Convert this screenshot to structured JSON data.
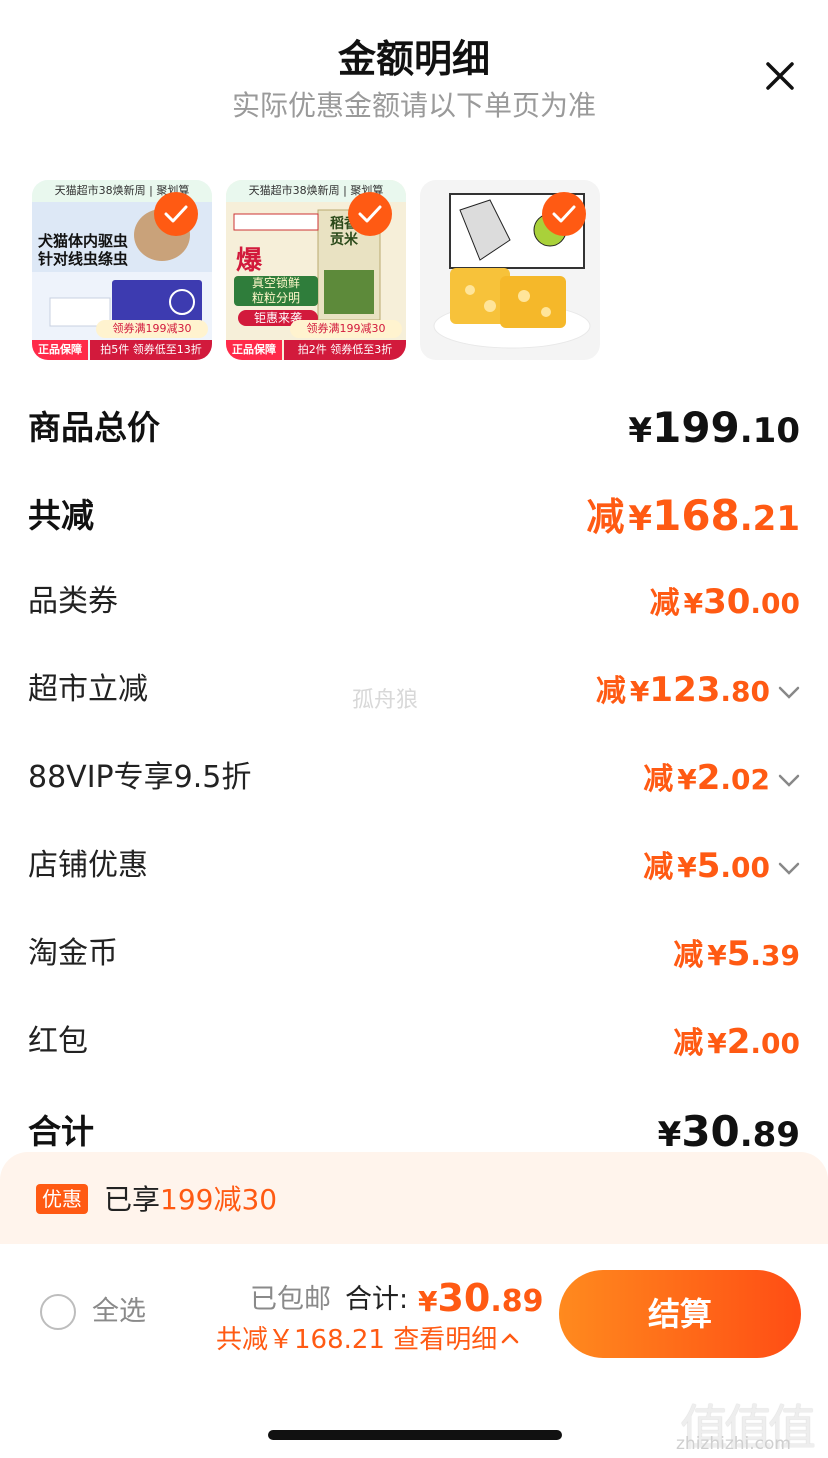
{
  "header": {
    "title": "金额明细",
    "subtitle": "实际优惠金额请以下单页为准"
  },
  "products": [
    {
      "top_banner": "天猫超市38焕新周 | 聚划算",
      "lines": [
        "犬猫体内驱虫",
        "针对线虫绦虫"
      ],
      "badge": "正品保障",
      "coupon": "领券满199减30",
      "promo": "拍5件 领券低至13折",
      "selected": true
    },
    {
      "top_banner": "天猫超市38焕新周 | 聚划算",
      "lines": [
        "爆",
        "稻香贡米",
        "真空锁鲜",
        "粒粒分明",
        "钜惠来袭"
      ],
      "badge": "正品保障",
      "coupon": "领券满199减30",
      "promo": "拍2件 领券低至3折",
      "selected": true
    },
    {
      "selected": true
    }
  ],
  "summary": {
    "subtotal": {
      "label": "商品总价",
      "currency": "¥",
      "int": "199",
      "dec": ".10"
    },
    "total_discount": {
      "label": "共减",
      "prefix": "减",
      "currency": "¥",
      "int": "168",
      "dec": ".21"
    },
    "items": [
      {
        "label": "品类券",
        "prefix": "减",
        "currency": "¥",
        "int": "30",
        "dec": ".00",
        "expandable": false
      },
      {
        "label": "超市立减",
        "prefix": "减",
        "currency": "¥",
        "int": "123",
        "dec": ".80",
        "expandable": true
      },
      {
        "label": "88VIP专享9.5折",
        "prefix": "减",
        "currency": "¥",
        "int": "2",
        "dec": ".02",
        "expandable": true
      },
      {
        "label": "店铺优惠",
        "prefix": "减",
        "currency": "¥",
        "int": "5",
        "dec": ".00",
        "expandable": true
      },
      {
        "label": "淘金币",
        "prefix": "减",
        "currency": "¥",
        "int": "5",
        "dec": ".39",
        "expandable": false
      },
      {
        "label": "红包",
        "prefix": "减",
        "currency": "¥",
        "int": "2",
        "dec": ".00",
        "expandable": false
      }
    ],
    "total": {
      "label": "合计",
      "currency": "¥",
      "int": "30",
      "dec": ".89"
    }
  },
  "watermark": "孤舟狼",
  "promo_band": {
    "tag": "优惠",
    "text_prefix": "已享",
    "text_highlight": "199减30"
  },
  "bottom_bar": {
    "select_all": "全选",
    "shipping": "已包邮",
    "total_label": "合计:",
    "total_currency": "¥",
    "total_int": "30",
    "total_dec": ".89",
    "save_text": "共减￥168.21 查看明细",
    "pay_button": "结算"
  },
  "site_watermark": {
    "logo": "值值值",
    "url": "zhizhizhi.com"
  },
  "colors": {
    "accent": "#ff5a13",
    "text": "#111111",
    "muted": "#9a9a9a",
    "promo_bg": "#fff4ec"
  }
}
